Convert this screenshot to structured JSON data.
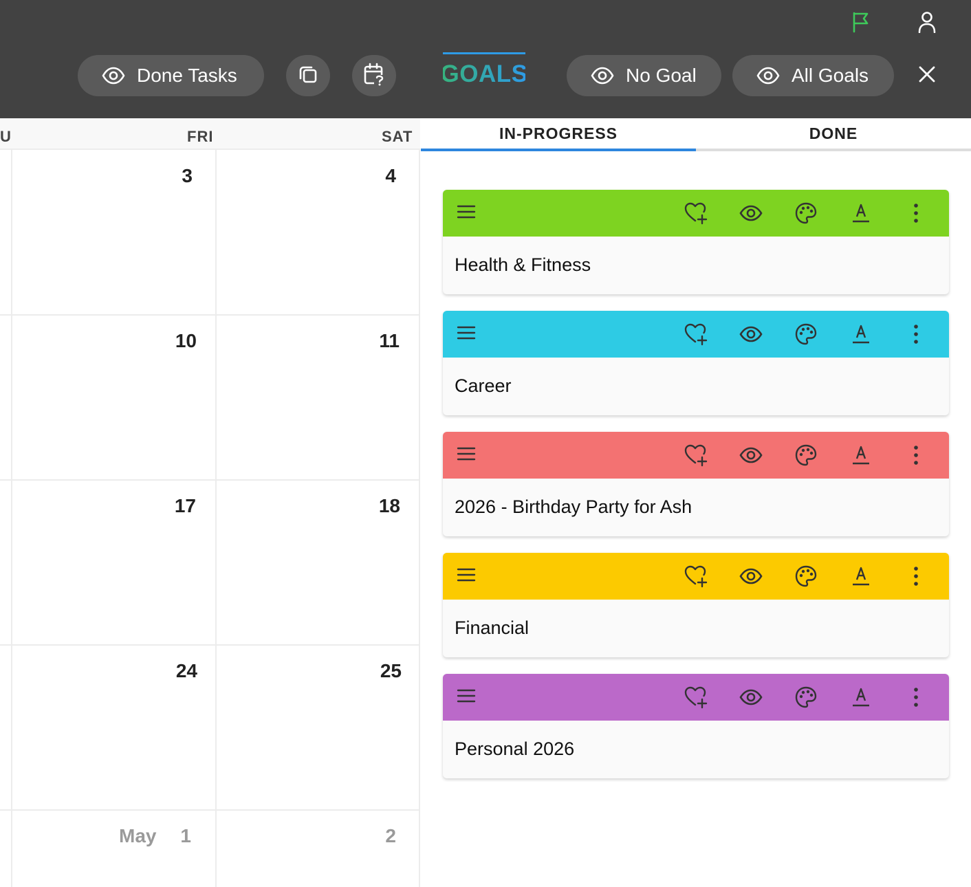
{
  "toolbar": {
    "done_tasks_label": "Done Tasks",
    "title": "GOALS",
    "no_goal_label": "No Goal",
    "all_goals_label": "All Goals",
    "icons": [
      "flag-icon",
      "user-icon",
      "copy-icon",
      "calendar-question-icon",
      "close-icon"
    ],
    "flag_color": "#3ec95a"
  },
  "calendar": {
    "headers": [
      "U",
      "FRI",
      "SAT"
    ],
    "weeks": [
      {
        "fri": "3",
        "sat": "4"
      },
      {
        "fri": "10",
        "sat": "11"
      },
      {
        "fri": "17",
        "sat": "18"
      },
      {
        "fri": "24",
        "sat": "25"
      },
      {
        "month": "May",
        "fri": "1",
        "sat": "2"
      }
    ]
  },
  "tabs": {
    "in_progress": "IN-PROGRESS",
    "done": "DONE",
    "active": "IN-PROGRESS"
  },
  "goals": [
    {
      "title": "Health & Fitness",
      "color": "#7ed321"
    },
    {
      "title": "Career",
      "color": "#2ecbe4"
    },
    {
      "title": "2026 - Birthday Party for Ash",
      "color": "#f37272"
    },
    {
      "title": "Financial",
      "color": "#fcca00"
    },
    {
      "title": "Personal 2026",
      "color": "#bb69c9"
    }
  ],
  "card_icons": [
    "drag-handle-icon",
    "heart-plus-icon",
    "eye-icon",
    "palette-icon",
    "font-color-icon",
    "more-vert-icon"
  ]
}
